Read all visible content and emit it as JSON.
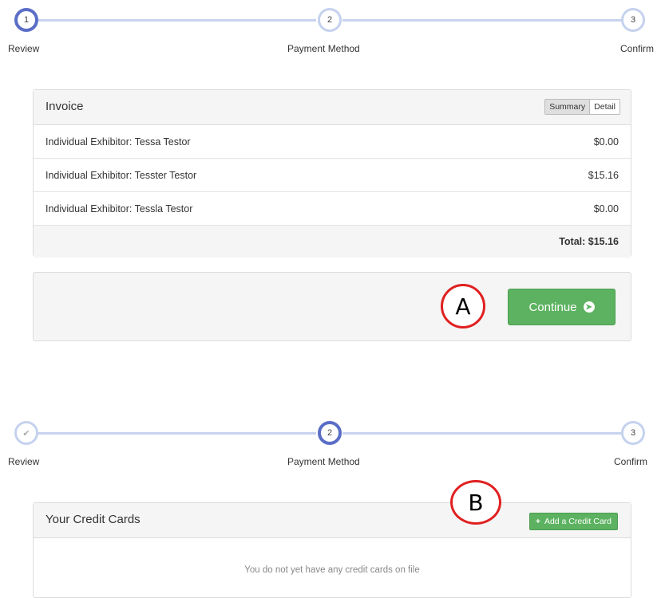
{
  "stepper1": {
    "steps": [
      {
        "number": "1",
        "label": "Review"
      },
      {
        "number": "2",
        "label": "Payment Method"
      },
      {
        "number": "3",
        "label": "Confirm"
      }
    ]
  },
  "invoice": {
    "title": "Invoice",
    "toggle": {
      "summary": "Summary",
      "detail": "Detail"
    },
    "rows": [
      {
        "name": "Individual Exhibitor: Tessa Testor",
        "amount": "$0.00"
      },
      {
        "name": "Individual Exhibitor: Tesster Testor",
        "amount": "$15.16"
      },
      {
        "name": "Individual Exhibitor: Tessla Testor",
        "amount": "$0.00"
      }
    ],
    "total": "Total: $15.16"
  },
  "actions": {
    "continue_label": "Continue",
    "continue_icon": "arrow-circle-right-icon",
    "marker_a": "A"
  },
  "stepper2": {
    "steps": [
      {
        "number": "✔",
        "label": "Review"
      },
      {
        "number": "2",
        "label": "Payment Method"
      },
      {
        "number": "3",
        "label": "Confirm"
      }
    ]
  },
  "credit_cards": {
    "title": "Your Credit Cards",
    "add_label": "Add a Credit Card",
    "add_icon": "plus-icon",
    "empty_message": "You do not yet have any credit cards on file",
    "marker_b": "B"
  },
  "colors": {
    "accent": "#5b6ec7",
    "success": "#5cb260",
    "marker": "#e02020"
  }
}
